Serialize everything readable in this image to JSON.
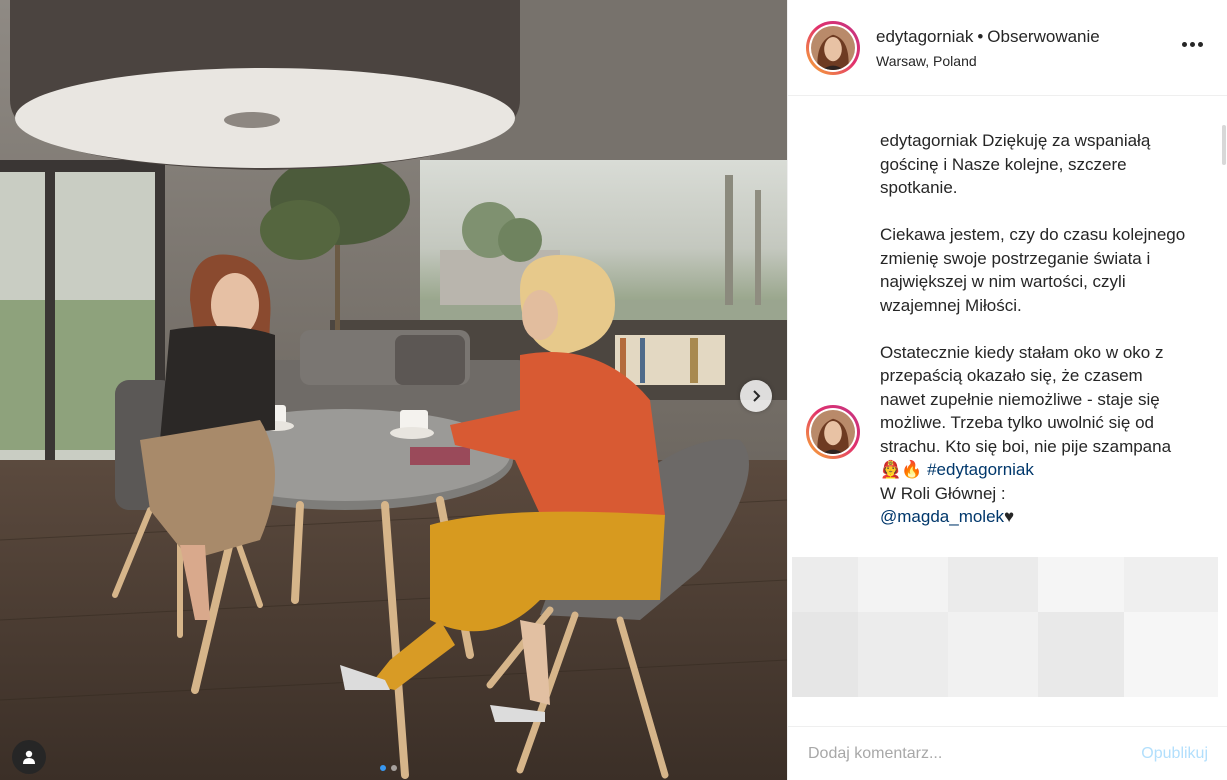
{
  "post": {
    "username": "edytagorniak",
    "separator": "•",
    "follow_label": "Obserwowanie",
    "location": "Warsaw, Poland",
    "more_icon": "more-horizontal-icon"
  },
  "caption": {
    "username": "edytagorniak",
    "para1_text": "Dziękuję za wspaniałą gościnę i Nasze kolejne, szczere spotkanie.",
    "para2_text": "Ciekawa jestem, czy do czasu kolejnego zmienię swoje postrzeganie świata i największej w nim wartości, czyli wzajemnej Miłości.",
    "para3_text": "Ostatecznie kiedy stałam oko w oko z przepaścią okazało się, że czasem nawet zupełnie niemożliwe - staje się możliwe. Trzeba tylko uwolnić się od strachu. Kto się boi, nie pije szampana",
    "emoji": "🧑‍🚒🔥",
    "hashtag": "#edytagorniak",
    "role_line": "W Roli Głównej :",
    "mention": "@magda_molek",
    "heart": "♥"
  },
  "comment_box": {
    "placeholder": "Dodaj komentarz...",
    "publish_label": "Opublikuj"
  },
  "carousel": {
    "slide_count": 2,
    "active_index": 0
  },
  "colors": {
    "link": "#00376b",
    "publish_disabled": "#b2dffc",
    "carousel_active": "#3897f0"
  }
}
